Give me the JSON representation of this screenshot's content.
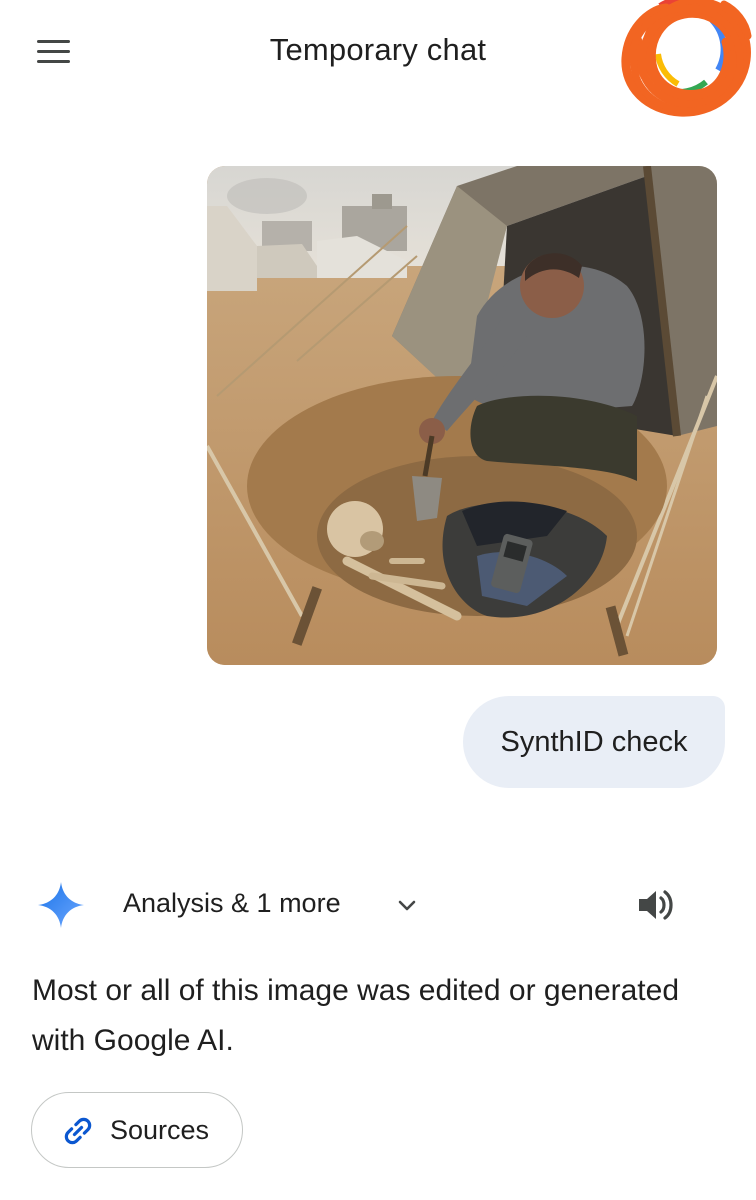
{
  "header": {
    "title": "Temporary chat",
    "menu_icon": "hamburger-menu-icon",
    "avatar_icon": "google-account-avatar"
  },
  "conversation": {
    "user_image": {
      "description_icon": "uploaded-photo"
    },
    "user_message": "SynthID check",
    "response": {
      "tools_label": "Analysis & 1 more",
      "spark_icon": "gemini-spark-icon",
      "expand_icon": "chevron-down-icon",
      "speaker_icon": "speaker-icon",
      "text": "Most or all of this image was edited or generated with Google AI.",
      "sources_label": "Sources",
      "sources_icon": "link-icon"
    }
  },
  "colors": {
    "bubble_bg": "#e9eef6",
    "gemini_blue": "#4285f4",
    "link_blue": "#0b57d0",
    "text": "#1f1f1f",
    "avatar_scribble": "#f26522"
  }
}
